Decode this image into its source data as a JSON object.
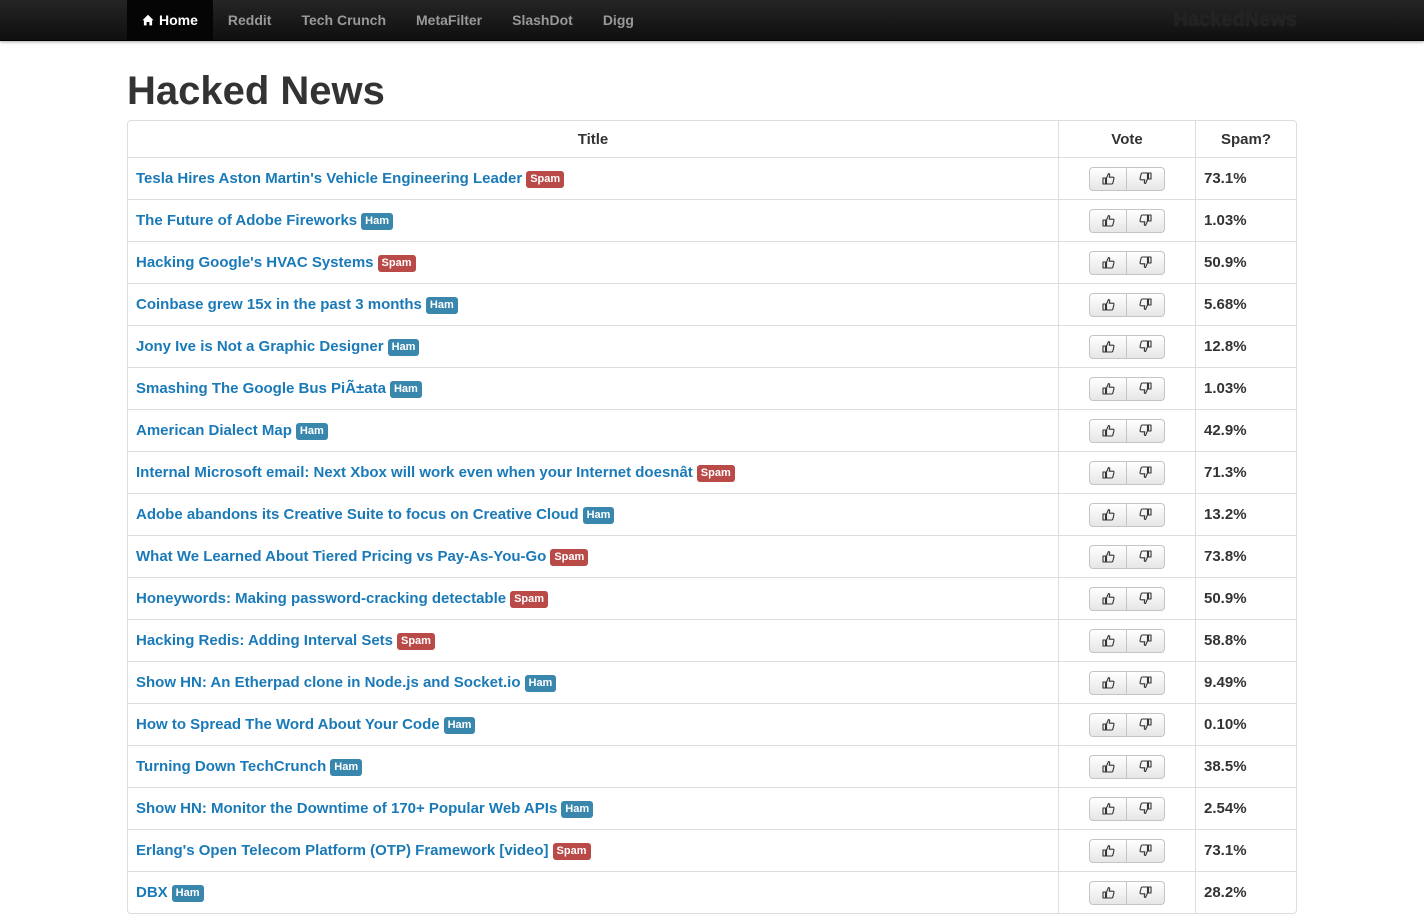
{
  "nav": {
    "items": [
      {
        "label": "Home",
        "active": true
      },
      {
        "label": "Reddit"
      },
      {
        "label": "Tech Crunch"
      },
      {
        "label": "MetaFilter"
      },
      {
        "label": "SlashDot"
      },
      {
        "label": "Digg"
      }
    ],
    "brand": "HackedNews"
  },
  "page": {
    "title": "Hacked News"
  },
  "table": {
    "headers": {
      "title": "Title",
      "vote": "Vote",
      "spam": "Spam?"
    },
    "rows": [
      {
        "title": "Tesla Hires Aston Martin's Vehicle Engineering Leader",
        "label": "Spam",
        "spam": "73.1%"
      },
      {
        "title": "The Future of Adobe Fireworks",
        "label": "Ham",
        "spam": "1.03%"
      },
      {
        "title": "Hacking Google's HVAC Systems",
        "label": "Spam",
        "spam": "50.9%"
      },
      {
        "title": "Coinbase grew 15x in the past 3 months",
        "label": "Ham",
        "spam": "5.68%"
      },
      {
        "title": "Jony Ive is Not a Graphic Designer",
        "label": "Ham",
        "spam": "12.8%"
      },
      {
        "title": "Smashing The Google Bus PiÃ±ata",
        "label": "Ham",
        "spam": "1.03%"
      },
      {
        "title": "American Dialect Map",
        "label": "Ham",
        "spam": "42.9%"
      },
      {
        "title": "Internal Microsoft email: Next Xbox will work even when your Internet doesnât",
        "label": "Spam",
        "spam": "71.3%"
      },
      {
        "title": "Adobe abandons its Creative Suite to focus on Creative Cloud",
        "label": "Ham",
        "spam": "13.2%"
      },
      {
        "title": "What We Learned About Tiered Pricing vs Pay-As-You-Go",
        "label": "Spam",
        "spam": "73.8%"
      },
      {
        "title": "Honeywords: Making password-cracking detectable",
        "label": "Spam",
        "spam": "50.9%"
      },
      {
        "title": "Hacking Redis: Adding Interval Sets",
        "label": "Spam",
        "spam": "58.8%"
      },
      {
        "title": "Show HN: An Etherpad clone in Node.js and Socket.io",
        "label": "Ham",
        "spam": "9.49%"
      },
      {
        "title": "How to Spread The Word About Your Code",
        "label": "Ham",
        "spam": "0.10%"
      },
      {
        "title": "Turning Down TechCrunch",
        "label": "Ham",
        "spam": "38.5%"
      },
      {
        "title": "Show HN: Monitor the Downtime of 170+ Popular Web APIs",
        "label": "Ham",
        "spam": "2.54%"
      },
      {
        "title": "Erlang's Open Telecom Platform (OTP) Framework [video]",
        "label": "Spam",
        "spam": "73.1%"
      },
      {
        "title": "DBX",
        "label": "Ham",
        "spam": "28.2%"
      }
    ]
  },
  "icons": {
    "home": "home-icon",
    "thumbs_up": "thumbs-up-icon",
    "thumbs_down": "thumbs-down-icon"
  },
  "colors": {
    "link": "#1a7ab8",
    "spam_label": "#b94a48",
    "ham_label": "#3a87ad",
    "navbar": "#1b1b1b"
  }
}
